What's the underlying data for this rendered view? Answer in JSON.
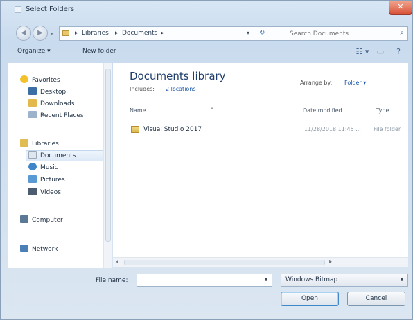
{
  "window": {
    "title": "Select Folders",
    "close_glyph": "✕"
  },
  "address": {
    "back_glyph": "◀",
    "forward_glyph": "▶",
    "recent_glyph": "▾",
    "crumbs": [
      "Libraries",
      "Documents"
    ],
    "separator": "▸",
    "dropdown_glyph": "▾",
    "refresh_glyph": "↻"
  },
  "search": {
    "placeholder": "Search Documents",
    "icon": "search-icon",
    "glyph": "⌕"
  },
  "toolbar": {
    "organize": "Organize ▾",
    "new_folder": "New folder",
    "views_glyph": "☷ ▾",
    "preview_glyph": "▭",
    "help_glyph": "?"
  },
  "nav": {
    "favorites": "Favorites",
    "desktop": "Desktop",
    "downloads": "Downloads",
    "recent_places": "Recent Places",
    "libraries": "Libraries",
    "documents": "Documents",
    "music": "Music",
    "pictures": "Pictures",
    "videos": "Videos",
    "computer": "Computer",
    "network": "Network"
  },
  "content": {
    "title": "Documents library",
    "includes_label": "Includes:",
    "includes_link": "2 locations",
    "arrange_label": "Arrange by:",
    "arrange_value": "Folder ▾",
    "columns": {
      "name": "Name",
      "date": "Date modified",
      "type": "Type"
    },
    "sort_glyph": "^",
    "files": [
      {
        "name": "Visual Studio 2017",
        "date": "11/28/2018 11:45 ...",
        "type": "File folder"
      }
    ]
  },
  "scroll": {
    "left_glyph": "◂",
    "right_glyph": "▸"
  },
  "footer": {
    "filename_label": "File name:",
    "filename_value": "",
    "filename_drop": "▾",
    "filter_value": "Windows Bitmap",
    "filter_arrow": "▾",
    "open_label": "Open",
    "cancel_label": "Cancel"
  },
  "colors": {
    "accent": "#1a55a8",
    "title_text": "#1e3d6b",
    "close_button": "#d9553b"
  }
}
